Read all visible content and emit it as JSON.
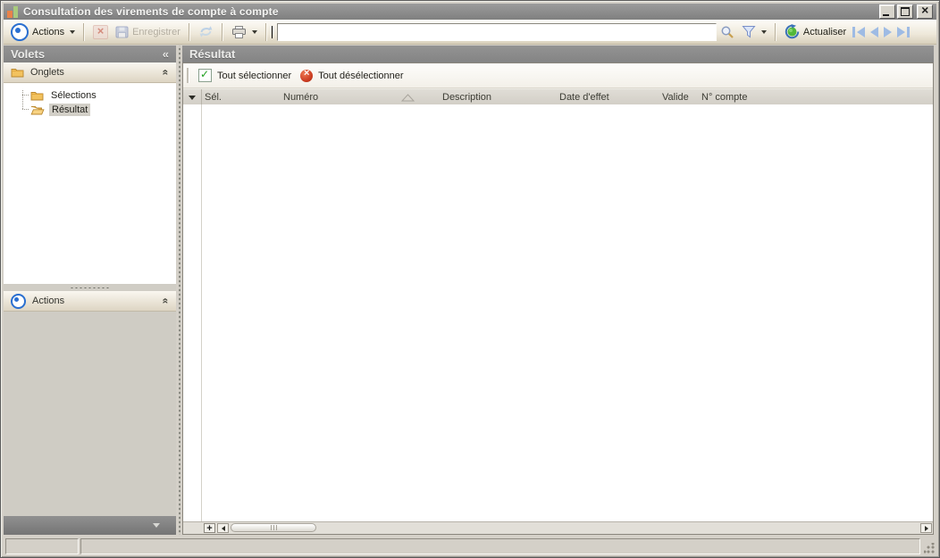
{
  "window": {
    "title": "Consultation des virements de compte à compte"
  },
  "toolbar": {
    "actions": {
      "label": "Actions"
    },
    "save": {
      "label": "Enregistrer",
      "enabled": false
    },
    "delete": {
      "enabled": false
    },
    "refresh": {
      "enabled": false
    },
    "filter_input": {
      "value": ""
    },
    "actualiser": {
      "label": "Actualiser"
    }
  },
  "left_panel": {
    "title": "Volets",
    "onglets": {
      "label": "Onglets",
      "items": [
        {
          "label": "Sélections",
          "selected": false
        },
        {
          "label": "Résultat",
          "selected": true
        }
      ]
    },
    "actions_section": {
      "label": "Actions"
    }
  },
  "main_panel": {
    "title": "Résultat",
    "select_toolbar": {
      "select_all": "Tout sélectionner",
      "deselect_all": "Tout désélectionner"
    },
    "table": {
      "columns": [
        "Sél.",
        "Numéro",
        "Description",
        "Date d'effet",
        "Valide",
        "N° compte"
      ],
      "sort_column": "Numéro",
      "sort_direction": "ascending",
      "rows": []
    },
    "hscrollbar": {
      "add_button": "+"
    }
  },
  "status_bar": {
    "cells": [
      "",
      ""
    ]
  },
  "icons": {
    "app": "bar-chart",
    "actions": "bullseye",
    "delete": "red-x",
    "save": "diskette",
    "refresh": "sync-arrows",
    "print": "printer",
    "search": "magnifier",
    "filter": "funnel",
    "actualiser": "green-refresh",
    "nav": [
      "first",
      "previous",
      "next",
      "last"
    ],
    "collapse_panel": "«",
    "collapse_section": "double-chevron-up",
    "sort": "triangle-up",
    "select_all": "green-check-box",
    "deselect_all": "red-circle-x"
  },
  "colors": {
    "chrome": "#d4d0c8",
    "titlebar": "#8b8b8b",
    "toolbar_top": "#fdfcf8",
    "toolbar_bottom": "#d8d0bc",
    "panel_header": "#8b8b8b",
    "accent_blue": "#2a6fd0",
    "nav_arrow": "#9ebbe4",
    "folder": "#f0bc55",
    "check_green": "#1fa01f",
    "deselect_red": "#c93a20",
    "refresh_green": "#52b83a"
  }
}
